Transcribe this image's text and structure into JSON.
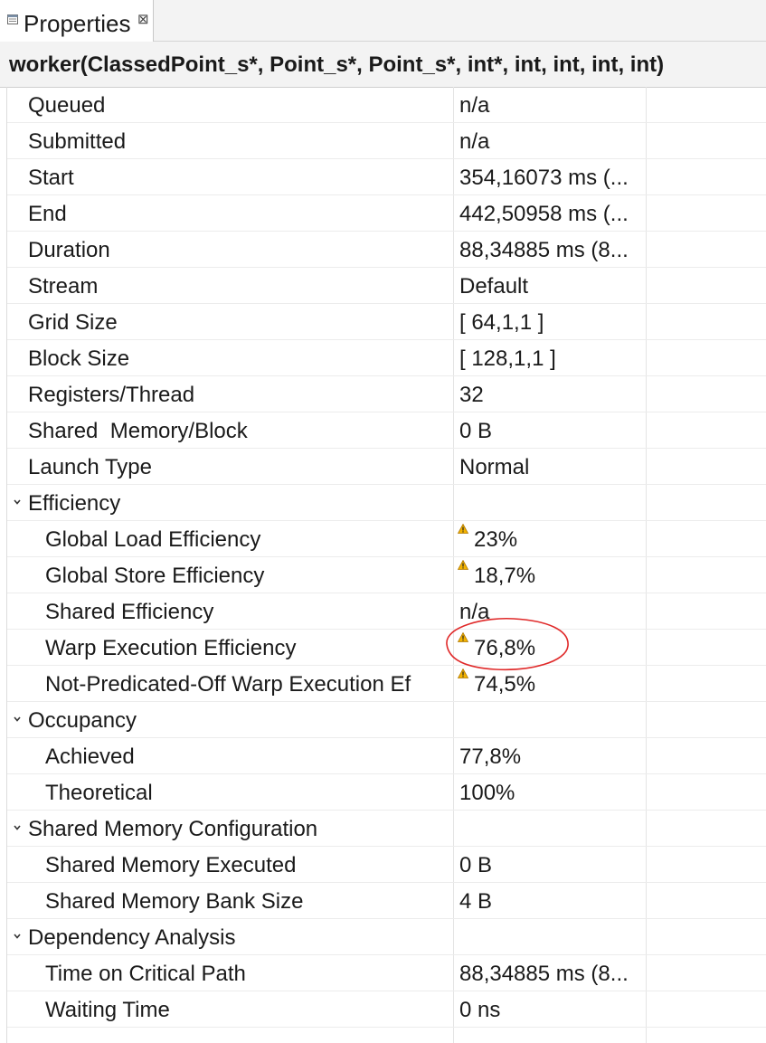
{
  "tab": {
    "label": "Properties",
    "close": "⊠",
    "icon": "properties-icon"
  },
  "title": "worker(ClassedPoint_s*, Point_s*, Point_s*, int*, int, int, int, int)",
  "rows": [
    {
      "name": "Queued",
      "value": "n/a"
    },
    {
      "name": "Submitted",
      "value": "n/a"
    },
    {
      "name": "Start",
      "value": "354,16073 ms (..."
    },
    {
      "name": "End",
      "value": "442,50958 ms (..."
    },
    {
      "name": "Duration",
      "value": "88,34885 ms (8..."
    },
    {
      "name": "Stream",
      "value": "Default"
    },
    {
      "name": "Grid Size",
      "value": "[ 64,1,1 ]"
    },
    {
      "name": "Block Size",
      "value": "[ 128,1,1 ]"
    },
    {
      "name": "Registers/Thread",
      "value": "32"
    },
    {
      "name": "Shared  Memory/Block",
      "value": "0 B"
    },
    {
      "name": "Launch Type",
      "value": "Normal"
    },
    {
      "name": "Efficiency",
      "value": ""
    },
    {
      "name": "Global Load Efficiency",
      "value": "23%"
    },
    {
      "name": "Global Store Efficiency",
      "value": "18,7%"
    },
    {
      "name": "Shared Efficiency",
      "value": "n/a"
    },
    {
      "name": "Warp Execution Efficiency",
      "value": "76,8%"
    },
    {
      "name": "Not-Predicated-Off Warp Execution Ef",
      "value": "74,5%"
    },
    {
      "name": "Occupancy",
      "value": ""
    },
    {
      "name": "Achieved",
      "value": "77,8%"
    },
    {
      "name": "Theoretical",
      "value": "100%"
    },
    {
      "name": "Shared Memory Configuration",
      "value": ""
    },
    {
      "name": "Shared Memory Executed",
      "value": "0 B"
    },
    {
      "name": "Shared Memory Bank Size",
      "value": "4 B"
    },
    {
      "name": "Dependency Analysis",
      "value": ""
    },
    {
      "name": "Time on Critical Path",
      "value": "88,34885 ms (8..."
    },
    {
      "name": "Waiting Time",
      "value": "0 ns"
    }
  ],
  "colors": {
    "warning": "#e8a317",
    "highlight_circle": "#e02a2a",
    "title_bg": "#f3f3f3"
  }
}
